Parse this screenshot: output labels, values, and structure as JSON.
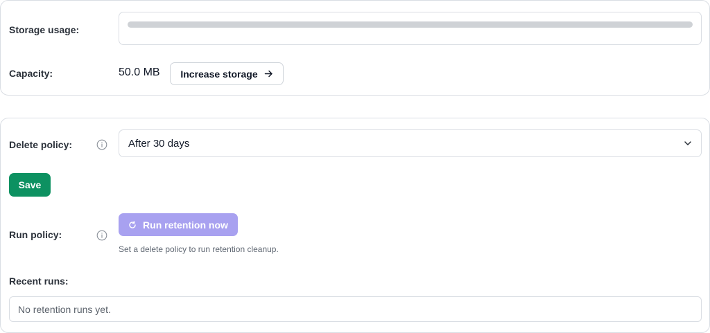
{
  "storage": {
    "usage_label": "Storage usage:",
    "usage_fraction": 0.0,
    "capacity_label": "Capacity:",
    "capacity_value": "50.0 MB",
    "increase_button": "Increase storage",
    "increase_icon": "arrow-right-icon"
  },
  "policy": {
    "delete_label": "Delete policy:",
    "delete_info_icon": "info-icon",
    "delete_selected": "After 30 days",
    "save_button": "Save",
    "run_label": "Run policy:",
    "run_info_icon": "info-icon",
    "run_button": "Run retention now",
    "run_icon": "refresh-icon",
    "run_hint": "Set a delete policy to run retention cleanup.",
    "recent_label": "Recent runs:",
    "recent_empty": "No retention runs yet."
  },
  "colors": {
    "save": "#0d9161",
    "run_disabled": "#a8a1f0",
    "border": "#d9dde3",
    "usage_track": "#cfd2d6"
  }
}
